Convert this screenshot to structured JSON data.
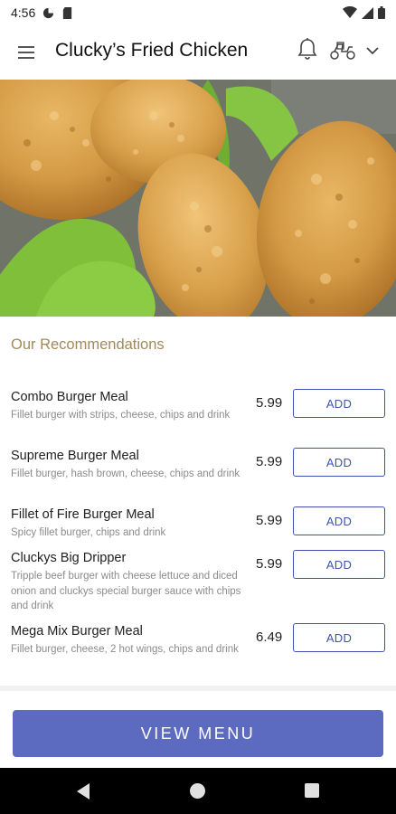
{
  "status_bar": {
    "time": "4:56",
    "icons": [
      "data-saver-icon",
      "sd-card-icon",
      "wifi-icon",
      "signal-icon",
      "battery-icon"
    ]
  },
  "app_bar": {
    "title": "Clucky’s Fried Chicken",
    "icons": [
      "hamburger-menu-icon",
      "bell-icon",
      "delivery-scooter-icon",
      "chevron-down-icon"
    ]
  },
  "hero": {
    "image": "fried-chicken-photo"
  },
  "recommendations": {
    "title": "Our Recommendations",
    "items": [
      {
        "name": "Combo Burger Meal",
        "desc": "Fillet burger with strips, cheese, chips and drink",
        "price": "5.99",
        "button": "ADD"
      },
      {
        "name": "Supreme Burger Meal",
        "desc": "Fillet burger, hash brown, cheese, chips and drink",
        "price": "5.99",
        "button": "ADD"
      },
      {
        "name": "Fillet of Fire Burger Meal",
        "desc": "Spicy fillet burger, chips and drink",
        "price": "5.99",
        "button": "ADD"
      },
      {
        "name": "Cluckys Big Dripper",
        "desc": "Tripple beef burger with cheese lettuce and diced onion and cluckys special burger sauce with chips and drink",
        "price": "5.99",
        "button": "ADD"
      },
      {
        "name": "Mega Mix Burger Meal",
        "desc": "Fillet burger, cheese, 2 hot wings, chips and drink",
        "price": "6.49",
        "button": "ADD"
      }
    ]
  },
  "footer": {
    "view_menu_label": "VIEW MENU"
  },
  "colors": {
    "accent": "#3f51b5",
    "button_fill": "#5c6bc0",
    "section_title": "#a2895c"
  }
}
